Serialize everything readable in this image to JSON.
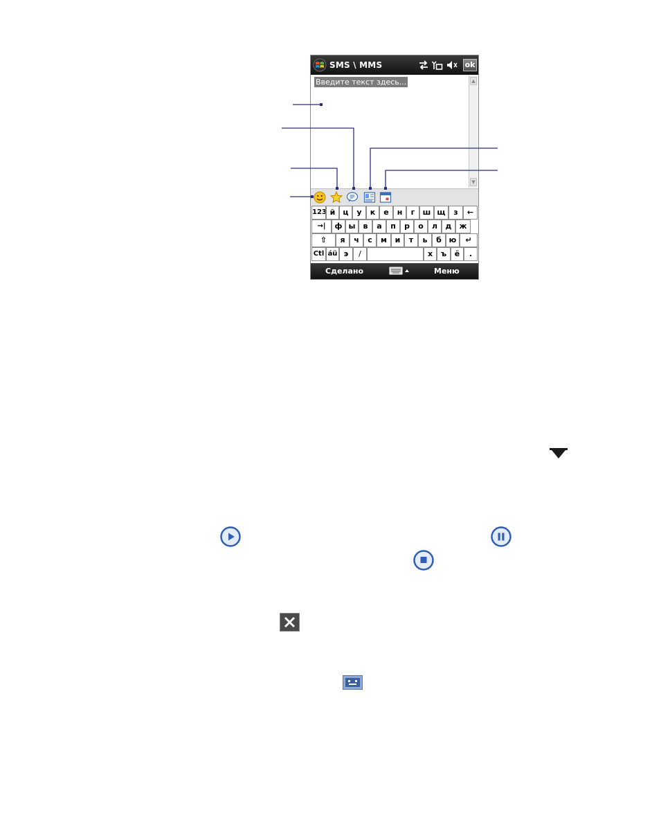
{
  "window": {
    "title": "SMS \\ MMS",
    "ok_label": "ok"
  },
  "compose": {
    "placeholder": "Введите текст здесь..."
  },
  "icon_bar": {
    "icons": [
      "emoticon-icon",
      "favorites-star-icon",
      "text-templates-icon",
      "contacts-card-icon",
      "calendar-icon"
    ]
  },
  "keyboard": {
    "row1": [
      "123",
      "й",
      "ц",
      "у",
      "к",
      "е",
      "н",
      "г",
      "ш",
      "щ",
      "з",
      "←"
    ],
    "row2": [
      "→|",
      "ф",
      "ы",
      "в",
      "а",
      "п",
      "р",
      "о",
      "л",
      "д",
      "ж"
    ],
    "row3": [
      "⇧",
      "я",
      "ч",
      "с",
      "м",
      "и",
      "т",
      "ь",
      "б",
      "ю",
      "↵"
    ],
    "row4": [
      "Ctl",
      "áü",
      "э",
      "/",
      "",
      "х",
      "ъ",
      "ё",
      "."
    ]
  },
  "menu_bar": {
    "left_softkey": "Сделано",
    "right_softkey": "Меню"
  },
  "colors": {
    "callout_line": "#2b2c7c",
    "bar_dark": "#1a1a1a",
    "placeholder_bg": "#7b7b7b",
    "player_blue": "#2f5fb5"
  },
  "doc_icons": [
    "dropdown-arrow-icon",
    "play-button-icon",
    "pause-button-icon",
    "stop-button-icon",
    "close-x-icon",
    "keyboard-sip-icon"
  ]
}
